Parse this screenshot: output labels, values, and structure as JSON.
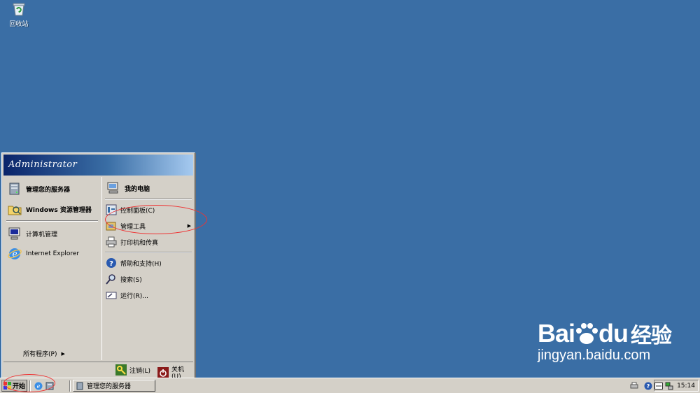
{
  "desktop": {
    "icons": [
      {
        "label": "回收站",
        "icon": "recycle-bin-icon"
      }
    ]
  },
  "start_menu": {
    "user": "Administrator",
    "left_items": [
      {
        "label": "管理您的服务器",
        "icon": "server-manage-icon",
        "bold": true
      },
      {
        "label": "Windows 资源管理器",
        "icon": "explorer-folder-icon",
        "bold": true
      },
      {
        "label": "计算机管理",
        "icon": "computer-management-icon",
        "bold": false
      },
      {
        "label": "Internet Explorer",
        "icon": "internet-explorer-icon",
        "bold": false
      }
    ],
    "all_programs": "所有程序(P)",
    "right_items": [
      {
        "label": "我的电脑",
        "icon": "my-computer-icon",
        "bold": true
      },
      {
        "label": "控制面板(C)",
        "icon": "control-panel-icon"
      },
      {
        "label": "管理工具",
        "icon": "admin-tools-icon",
        "submenu": true
      },
      {
        "label": "打印机和传真",
        "icon": "printer-icon"
      },
      {
        "label": "帮助和支持(H)",
        "icon": "help-icon"
      },
      {
        "label": "搜索(S)",
        "icon": "search-icon"
      },
      {
        "label": "运行(R)...",
        "icon": "run-icon"
      }
    ],
    "footer": {
      "logoff": "注销(L)",
      "shutdown": "关机(U)"
    }
  },
  "taskbar": {
    "start_label": "开始",
    "task_button": "管理您的服务器",
    "clock": "15:14"
  },
  "watermark": {
    "brand_a": "Bai",
    "brand_b": "du",
    "brand_c": "经验",
    "url": "jingyan.baidu.com"
  },
  "colors": {
    "desktop": "#3a6ea5",
    "menu_bg": "#d4d0c8",
    "annotation": "#e33333"
  }
}
